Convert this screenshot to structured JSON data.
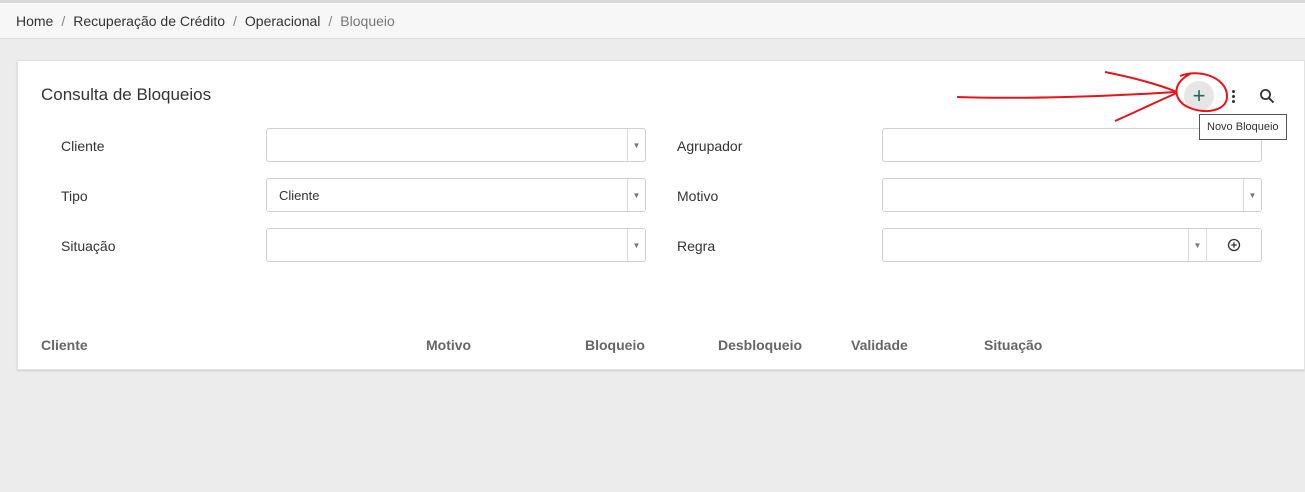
{
  "breadcrumb": {
    "items": [
      "Home",
      "Recuperação de Crédito",
      "Operacional",
      "Bloqueio"
    ],
    "separator": "/"
  },
  "card": {
    "title": "Consulta de Bloqueios",
    "toolbar": {
      "add_icon": "plus-icon",
      "more_icon": "kebab-menu-icon",
      "search_icon": "search-icon",
      "add_tooltip": "Novo Bloqueio"
    }
  },
  "filters": {
    "cliente": {
      "label": "Cliente",
      "value": ""
    },
    "tipo": {
      "label": "Tipo",
      "value": "Cliente"
    },
    "situacao": {
      "label": "Situação",
      "value": ""
    },
    "agrupador": {
      "label": "Agrupador",
      "value": ""
    },
    "motivo": {
      "label": "Motivo",
      "value": ""
    },
    "regra": {
      "label": "Regra",
      "value": ""
    }
  },
  "table": {
    "columns": [
      "Cliente",
      "Motivo",
      "Bloqueio",
      "Desbloqueio",
      "Validade",
      "Situação"
    ]
  },
  "colors": {
    "accent": "#1d6a5e",
    "annotation": "#e8121a"
  }
}
